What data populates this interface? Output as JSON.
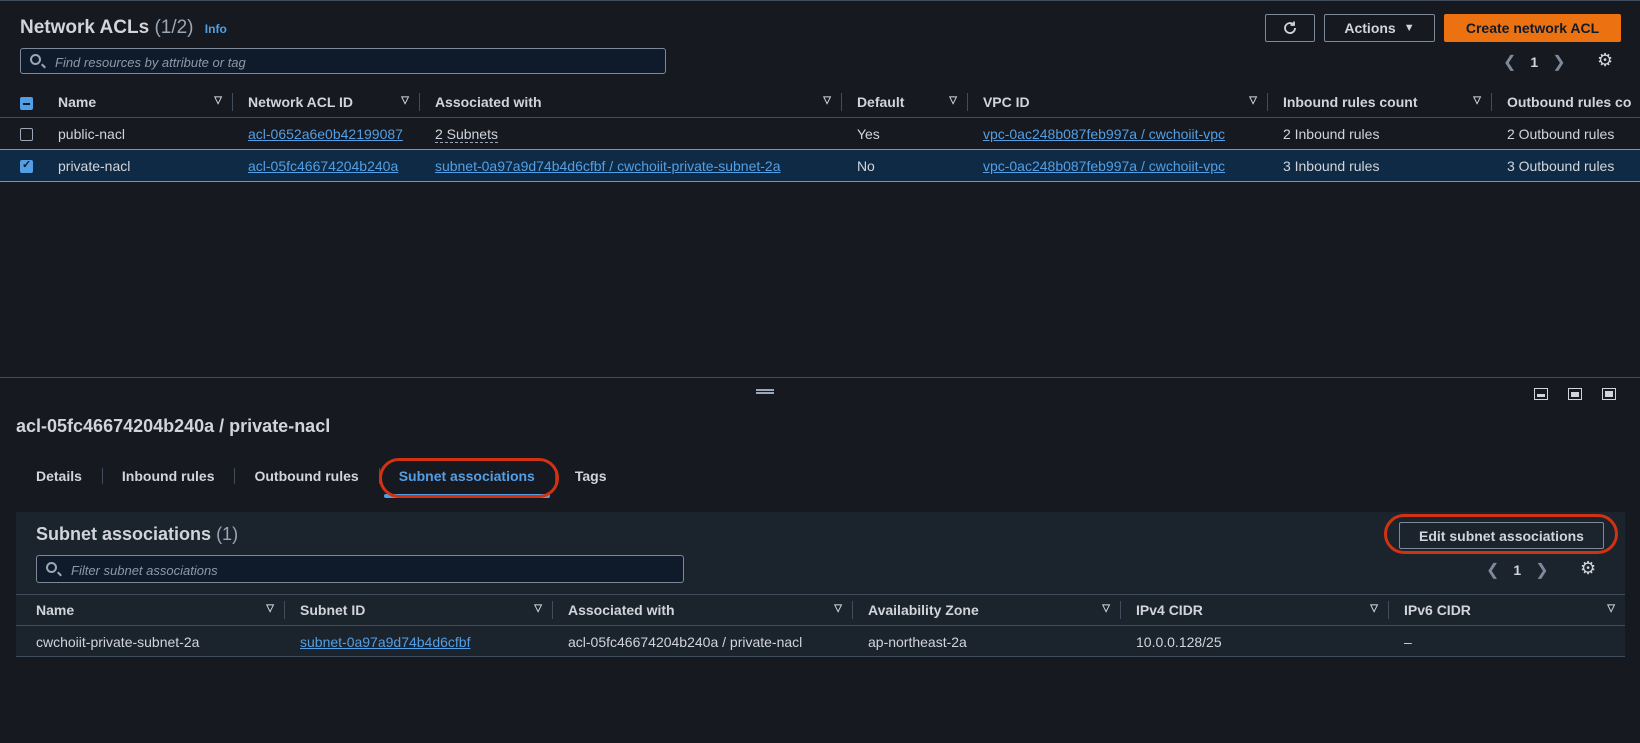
{
  "header": {
    "title": "Network ACLs",
    "count": "(1/2)",
    "info": "Info",
    "actions_label": "Actions",
    "create_label": "Create network ACL"
  },
  "search": {
    "placeholder": "Find resources by attribute or tag"
  },
  "pagination": {
    "page": "1"
  },
  "acl_table": {
    "columns": [
      "Name",
      "Network ACL ID",
      "Associated with",
      "Default",
      "VPC ID",
      "Inbound rules count",
      "Outbound rules co"
    ],
    "rows": [
      {
        "selected": false,
        "name": "public-nacl",
        "acl_id": "acl-0652a6e0b42199087",
        "associated": "2 Subnets",
        "default": "Yes",
        "vpc_id": "vpc-0ac248b087feb997a / cwchoiit-vpc",
        "inbound": "2 Inbound rules",
        "outbound": "2 Outbound rules"
      },
      {
        "selected": true,
        "name": "private-nacl",
        "acl_id": "acl-05fc46674204b240a",
        "associated": "subnet-0a97a9d74b4d6cfbf / cwchoiit-private-subnet-2a",
        "default": "No",
        "vpc_id": "vpc-0ac248b087feb997a / cwchoiit-vpc",
        "inbound": "3 Inbound rules",
        "outbound": "3 Outbound rules"
      }
    ]
  },
  "detail": {
    "title": "acl-05fc46674204b240a / private-nacl",
    "tabs": [
      "Details",
      "Inbound rules",
      "Outbound rules",
      "Subnet associations",
      "Tags"
    ],
    "active_tab": "Subnet associations"
  },
  "subnet_assoc": {
    "title": "Subnet associations",
    "count": "(1)",
    "edit_label": "Edit subnet associations",
    "filter_placeholder": "Filter subnet associations",
    "page": "1",
    "columns": [
      "Name",
      "Subnet ID",
      "Associated with",
      "Availability Zone",
      "IPv4 CIDR",
      "IPv6 CIDR"
    ],
    "rows": [
      {
        "name": "cwchoiit-private-subnet-2a",
        "subnet_id": "subnet-0a97a9d74b4d6cfbf",
        "associated": "acl-05fc46674204b240a / private-nacl",
        "az": "ap-northeast-2a",
        "ipv4": "10.0.0.128/25",
        "ipv6": "–"
      }
    ]
  },
  "colors": {
    "accent": "#539fe5",
    "primary_button": "#ec7211",
    "highlight_ring": "#d13212",
    "background": "#16191f"
  },
  "icons": [
    "refresh-icon",
    "caret-down-icon",
    "search-icon",
    "chevron-left-icon",
    "chevron-right-icon",
    "settings-gear-icon",
    "drag-handle-icon"
  ]
}
